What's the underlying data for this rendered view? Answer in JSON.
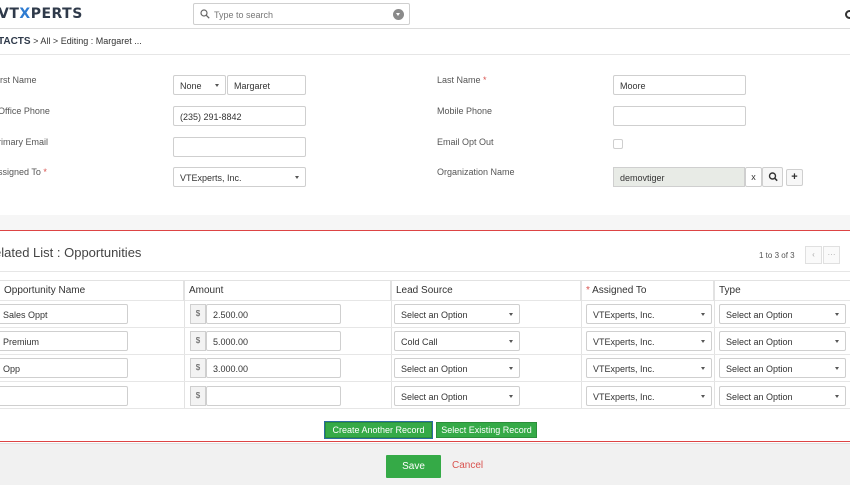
{
  "header": {
    "logo_prefix": "VT",
    "logo_x": "X",
    "logo_suffix": "PERTS",
    "search_placeholder": "Type to search"
  },
  "breadcrumb": {
    "module": "TACTS",
    "sep1": ">",
    "all": "All",
    "sep2": ">",
    "editing": "Editing : Margaret ..."
  },
  "form": {
    "first_name_label": "irst Name",
    "salutation": "None",
    "first_name": "Margaret",
    "last_name_label": "Last Name",
    "last_name": "Moore",
    "office_phone_label": "Office Phone",
    "office_phone": "(235) 291-8842",
    "mobile_phone_label": "Mobile Phone",
    "mobile_phone": "",
    "primary_email_label": "rimary Email",
    "primary_email": "",
    "email_opt_out_label": "Email Opt Out",
    "assigned_to_label": "ssigned To",
    "assigned_to": "VTExperts, Inc.",
    "organization_label": "Organization Name",
    "organization": "demovtiger",
    "required_mark": "*"
  },
  "related": {
    "title": "elated List : Opportunities",
    "pager_text": "1 to 3 of 3",
    "prev": "‹",
    "more": "···",
    "columns": {
      "name": "Opportunity Name",
      "amount": "Amount",
      "lead_source": "Lead Source",
      "assigned_to": "Assigned To",
      "type": "Type"
    },
    "currency": "$",
    "rows": [
      {
        "name": "Sales Oppt",
        "amount": "2.500.00",
        "lead_source": "Select an Option",
        "assigned_to": "VTExperts, Inc.",
        "type": "Select an Option"
      },
      {
        "name": "Premium",
        "amount": "5.000.00",
        "lead_source": "Cold Call",
        "assigned_to": "VTExperts, Inc.",
        "type": "Select an Option"
      },
      {
        "name": "Opp",
        "amount": "3.000.00",
        "lead_source": "Select an Option",
        "assigned_to": "VTExperts, Inc.",
        "type": "Select an Option"
      },
      {
        "name": "",
        "amount": "",
        "lead_source": "Select an Option",
        "assigned_to": "VTExperts, Inc.",
        "type": "Select an Option"
      }
    ],
    "create_another": "Create Another Record",
    "select_existing": "Select Existing Record"
  },
  "footer": {
    "save": "Save",
    "cancel": "Cancel"
  }
}
